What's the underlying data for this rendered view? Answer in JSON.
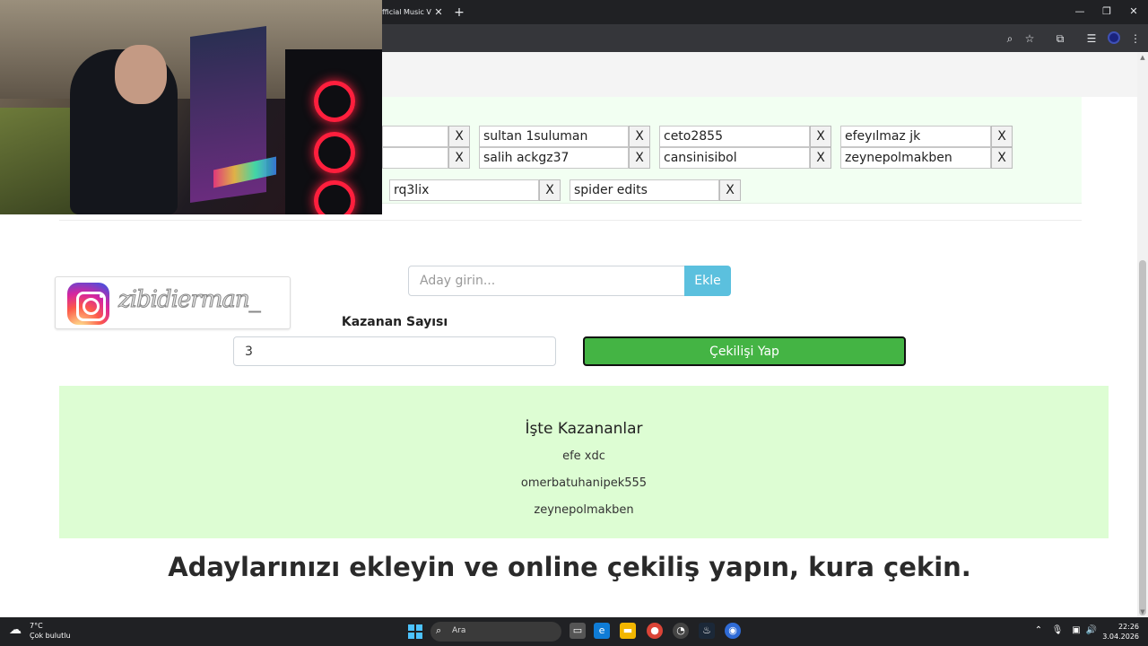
{
  "browser": {
    "tab_title": "fficial Music V",
    "close_glyph": "✕",
    "new_tab_glyph": "+",
    "minimize_glyph": "—",
    "maximize_glyph": "❐",
    "window_close_glyph": "✕"
  },
  "candidates": [
    {
      "name": "sultan 1suluman",
      "remove_label": "X"
    },
    {
      "name": "ceto2855",
      "remove_label": "X"
    },
    {
      "name": "efeyılmaz jk",
      "remove_label": "X"
    },
    {
      "name": "salih ackgz37",
      "remove_label": "X"
    },
    {
      "name": "cansinisibol",
      "remove_label": "X"
    },
    {
      "name": "zeynepolmakben",
      "remove_label": "X"
    },
    {
      "name": "rq3lix",
      "remove_label": "X"
    },
    {
      "name": "spider edits",
      "remove_label": "X"
    }
  ],
  "partial_remove_label": "X",
  "instagram": {
    "handle": "zibidierman_"
  },
  "form": {
    "aday_placeholder": "Aday girin...",
    "ekle_label": "Ekle",
    "kazanan_label": "Kazanan Sayısı",
    "kazanan_value": "3",
    "cekilis_label": "Çekilişi Yap"
  },
  "winners": {
    "title": "İşte Kazananlar",
    "list": [
      "efe xdc",
      "omerbatuhanipek555",
      "zeynepolmakben"
    ]
  },
  "headline": "Adaylarınızı ekleyin ve online çekiliş yapın, kura çekin.",
  "taskbar": {
    "temperature": "7°C",
    "condition": "Çok bulutlu",
    "search_placeholder": "Ara",
    "time": "22:26",
    "date": "3.04.2026"
  }
}
